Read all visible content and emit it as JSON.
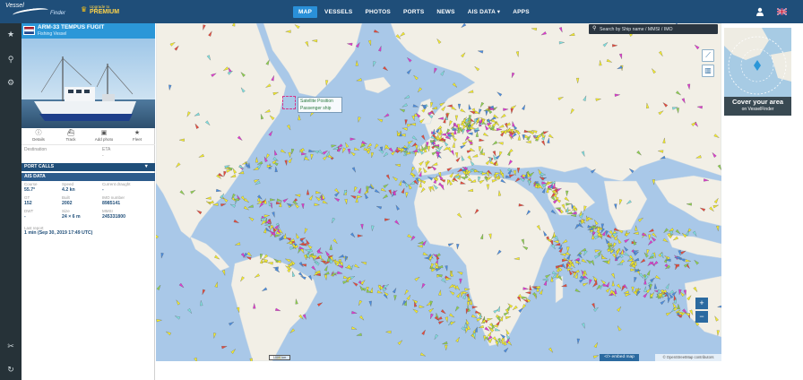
{
  "brand": {
    "logo": "Vessel",
    "logo_sub": "Finder",
    "upgrade": "Upgrade to",
    "premium": "PREMIUM"
  },
  "nav": {
    "items": [
      {
        "label": "MAP"
      },
      {
        "label": "VESSELS"
      },
      {
        "label": "PHOTOS"
      },
      {
        "label": "PORTS"
      },
      {
        "label": "NEWS"
      },
      {
        "label": "AIS DATA ▾"
      },
      {
        "label": "APPS"
      }
    ]
  },
  "vessel": {
    "name": "ARM-33 TEMPUS FUGIT",
    "type": "Fishing Vessel",
    "actions": [
      {
        "label": "Details",
        "icon": "info-icon"
      },
      {
        "label": "Track",
        "icon": "track-icon"
      },
      {
        "label": "Add photo",
        "icon": "camera-icon"
      },
      {
        "label": "Fleet",
        "icon": "star-icon"
      }
    ],
    "destination_label": "Destination",
    "eta_label": "ETA",
    "eta_value": "-",
    "port_calls_label": "PORT CALLS",
    "ais_label": "AIS DATA",
    "ais": [
      {
        "k": "Course",
        "v": "55.7°"
      },
      {
        "k": "Speed",
        "v": "4.2 kn"
      },
      {
        "k": "Current draught",
        "v": "-"
      },
      {
        "k": "GT",
        "v": "152"
      },
      {
        "k": "Built",
        "v": "2002"
      },
      {
        "k": "IMO number",
        "v": "8985141"
      },
      {
        "k": "DWT",
        "v": "-"
      },
      {
        "k": "Size",
        "v": "24 × 6 m"
      },
      {
        "k": "MMSI",
        "v": "245331800"
      }
    ],
    "last_report_label": "Last report",
    "last_report_value": "1 min (Sep 30, 2019 17:49 UTC)"
  },
  "map": {
    "search_placeholder": "Search by Ship name / MMSI / IMO",
    "tooltip_title": "Satellite Position",
    "tooltip_sub": "Passenger ship",
    "embed_label": "</> embed map",
    "attribution": "© OpenStreetMap contributors",
    "scale": "1000 km"
  },
  "ad": {
    "title": "Cover your area",
    "sub": "on VesselFinder"
  },
  "colors": {
    "topbar": "#1f4e79",
    "accent": "#2b97d8",
    "sidebar": "#263238",
    "ocean": "#a9c8e8",
    "land": "#f2efe6"
  }
}
